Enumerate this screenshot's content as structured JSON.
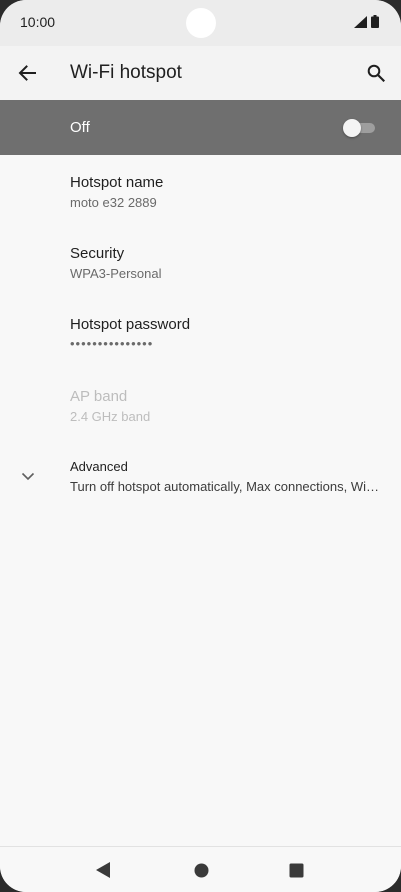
{
  "status_bar": {
    "time": "10:00",
    "icons": [
      "signal-icon",
      "battery-icon"
    ]
  },
  "app_bar": {
    "title": "Wi-Fi hotspot",
    "back_icon": "arrow-left-icon",
    "search_icon": "search-icon"
  },
  "master_switch": {
    "label": "Off",
    "checked": false
  },
  "prefs": {
    "hotspot_name": {
      "title": "Hotspot name",
      "summary": "moto e32 2889"
    },
    "security": {
      "title": "Security",
      "summary": "WPA3-Personal"
    },
    "password": {
      "title": "Hotspot password",
      "summary": "•••••••••••••••"
    },
    "ap_band": {
      "title": "AP band",
      "summary": "2.4 GHz band",
      "enabled": false
    },
    "advanced": {
      "title": "Advanced",
      "summary": "Turn off hotspot automatically, Max connections, Wi-Fi hotspot timeout"
    }
  },
  "nav_bar": {
    "icons": [
      "back-triangle-icon",
      "home-circle-icon",
      "recents-square-icon"
    ]
  },
  "colors": {
    "master_bar_bg": "#6f6f6f",
    "app_bar_bg": "#f3f3f3",
    "background": "#f8f8f8"
  }
}
